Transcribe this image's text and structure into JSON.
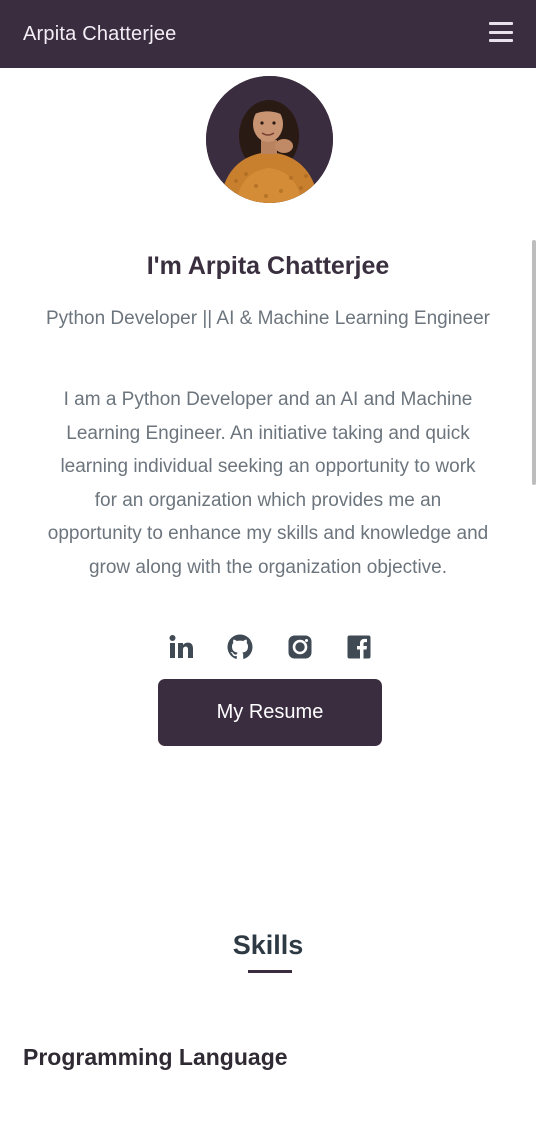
{
  "header": {
    "brand": "Arpita Chatterjee",
    "menu_icon": "hamburger-menu-icon"
  },
  "hero": {
    "avatar_alt": "profile-photo",
    "title": "I'm Arpita Chatterjee",
    "subtitle": "Python Developer || AI & Machine Learning Engineer",
    "description_lines": [
      "I am a Python Developer and an AI and Machine",
      "Learning Engineer. An initiative taking and quick",
      "learning individual seeking an opportunity to work",
      "for an organization which provides me an",
      "opportunity to enhance my skills and knowledge and",
      "grow along with the organization objective."
    ]
  },
  "social": {
    "icons": [
      "linkedin-icon",
      "github-icon",
      "instagram-icon",
      "facebook-icon"
    ],
    "color": "#3f4a55"
  },
  "resume_button": {
    "label": "My Resume"
  },
  "skills": {
    "title": "Skills",
    "categories": [
      "Programming Language"
    ]
  },
  "theme": {
    "primary": "#3b2d40",
    "text_muted": "#6c757d"
  }
}
